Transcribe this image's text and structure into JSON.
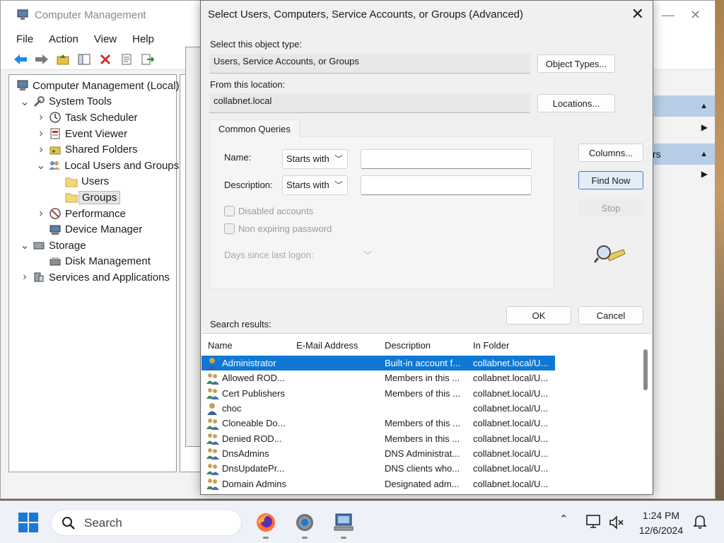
{
  "cm_window": {
    "title": "Computer Management",
    "menu": [
      "File",
      "Action",
      "View",
      "Help"
    ],
    "tree": [
      {
        "label": "Computer Management (Local)",
        "level": 0,
        "expander": "",
        "icon": "computer-mgmt-icon"
      },
      {
        "label": "System Tools",
        "level": 1,
        "expander": "v",
        "icon": "system-tools-icon"
      },
      {
        "label": "Task Scheduler",
        "level": 2,
        "expander": ">",
        "icon": "clock-icon"
      },
      {
        "label": "Event Viewer",
        "level": 2,
        "expander": ">",
        "icon": "event-viewer-icon"
      },
      {
        "label": "Shared Folders",
        "level": 2,
        "expander": ">",
        "icon": "shared-folder-icon"
      },
      {
        "label": "Local Users and Groups",
        "level": 2,
        "expander": "v",
        "icon": "users-groups-icon"
      },
      {
        "label": "Users",
        "level": 3,
        "expander": "",
        "icon": "folder-icon"
      },
      {
        "label": "Groups",
        "level": 3,
        "expander": "",
        "icon": "folder-icon",
        "selected": true
      },
      {
        "label": "Performance",
        "level": 2,
        "expander": ">",
        "icon": "performance-icon"
      },
      {
        "label": "Device Manager",
        "level": 2,
        "expander": "",
        "icon": "device-manager-icon"
      },
      {
        "label": "Storage",
        "level": 1,
        "expander": "v",
        "icon": "storage-icon"
      },
      {
        "label": "Disk Management",
        "level": 2,
        "expander": "",
        "icon": "disk-icon"
      },
      {
        "label": "Services and Applications",
        "level": 1,
        "expander": ">",
        "icon": "services-icon"
      }
    ],
    "right_fragment": "rs"
  },
  "dialog": {
    "title": "Select Users, Computers, Service Accounts, or Groups (Advanced)",
    "object_type_label": "Select this object type:",
    "object_type_value": "Users, Service Accounts, or Groups",
    "object_types_button": "Object Types...",
    "location_label": "From this location:",
    "location_value": "collabnet.local",
    "locations_button": "Locations...",
    "common_queries_tab": "Common Queries",
    "name_label": "Name:",
    "name_mode": "Starts with",
    "name_value": "",
    "description_label": "Description:",
    "description_mode": "Starts with",
    "description_value": "",
    "disabled_accounts_label": "Disabled accounts",
    "non_expiring_label": "Non expiring password",
    "days_label": "Days since last logon:",
    "columns_button": "Columns...",
    "find_now_button": "Find Now",
    "stop_button": "Stop",
    "ok_button": "OK",
    "cancel_button": "Cancel",
    "search_results_label": "Search results:",
    "columns": [
      "Name",
      "E-Mail Address",
      "Description",
      "In Folder"
    ],
    "results": [
      {
        "name": "Administrator",
        "email": "",
        "description": "Built-in account f...",
        "folder": "collabnet.local/U...",
        "icon": "user-icon",
        "selected": true
      },
      {
        "name": "Allowed ROD...",
        "email": "",
        "description": "Members in this ...",
        "folder": "collabnet.local/U...",
        "icon": "group-icon"
      },
      {
        "name": "Cert Publishers",
        "email": "",
        "description": "Members of this ...",
        "folder": "collabnet.local/U...",
        "icon": "group-icon"
      },
      {
        "name": "choc",
        "email": "",
        "description": "",
        "folder": "collabnet.local/U...",
        "icon": "user-icon"
      },
      {
        "name": "Cloneable Do...",
        "email": "",
        "description": "Members of this ...",
        "folder": "collabnet.local/U...",
        "icon": "group-icon"
      },
      {
        "name": "Denied ROD...",
        "email": "",
        "description": "Members in this ...",
        "folder": "collabnet.local/U...",
        "icon": "group-icon"
      },
      {
        "name": "DnsAdmins",
        "email": "",
        "description": "DNS Administrat...",
        "folder": "collabnet.local/U...",
        "icon": "group-icon"
      },
      {
        "name": "DnsUpdatePr...",
        "email": "",
        "description": "DNS clients who...",
        "folder": "collabnet.local/U...",
        "icon": "group-icon"
      },
      {
        "name": "Domain Admins",
        "email": "",
        "description": "Designated adm...",
        "folder": "collabnet.local/U...",
        "icon": "group-icon"
      }
    ]
  },
  "taskbar": {
    "search_placeholder": "Search",
    "time": "1:24 PM",
    "date": "12/6/2024"
  },
  "colors": {
    "selection": "#0f78d4",
    "action_header": "#b8cde6",
    "taskbar": "#eef1f7"
  }
}
